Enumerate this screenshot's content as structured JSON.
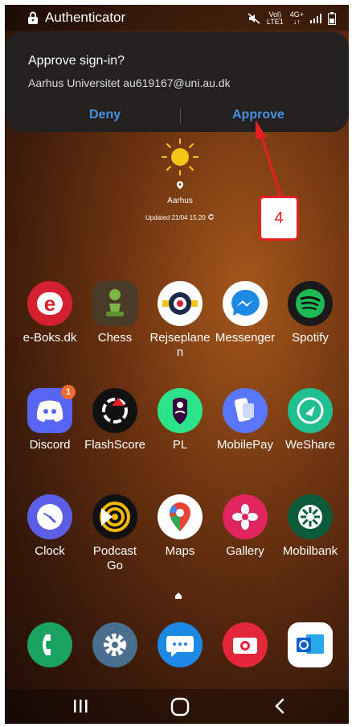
{
  "status_bar": {
    "app_name": "Authenticator",
    "signal_top": "Vol)",
    "signal_bottom": "LTE1",
    "net_top": "4G+",
    "net_bottom": "↓↑"
  },
  "notification": {
    "title": "Approve sign-in?",
    "subtitle": "Aarhus Universitet au619167@uni.au.dk",
    "deny_label": "Deny",
    "approve_label": "Approve",
    "accent_color": "#4a90e2"
  },
  "weather": {
    "location": "Aarhus",
    "updated": "Updated 21/04 15.20"
  },
  "annotation": {
    "step": "4",
    "color": "#e62020"
  },
  "apps": [
    {
      "label": "e-Boks.dk",
      "icon": "eboks-icon"
    },
    {
      "label": "Chess",
      "icon": "chess-pawn-icon"
    },
    {
      "label": "Rejseplane\nn",
      "icon": "rejseplanen-icon"
    },
    {
      "label": "Messenger",
      "icon": "messenger-icon"
    },
    {
      "label": "Spotify",
      "icon": "spotify-icon"
    },
    {
      "label": "Discord",
      "icon": "discord-icon",
      "badge": "1"
    },
    {
      "label": "FlashScore",
      "icon": "flashscore-icon"
    },
    {
      "label": "PL",
      "icon": "premier-league-icon"
    },
    {
      "label": "MobilePay",
      "icon": "mobilepay-icon"
    },
    {
      "label": "WeShare",
      "icon": "weshare-icon"
    },
    {
      "label": "Clock",
      "icon": "clock-icon"
    },
    {
      "label": "Podcast\nGo",
      "icon": "podcast-go-icon"
    },
    {
      "label": "Maps",
      "icon": "maps-pin-icon"
    },
    {
      "label": "Gallery",
      "icon": "gallery-flower-icon"
    },
    {
      "label": "Mobilbank",
      "icon": "mobilbank-icon"
    }
  ],
  "dock": [
    {
      "icon": "phone-icon"
    },
    {
      "icon": "settings-gear-icon"
    },
    {
      "icon": "messages-icon"
    },
    {
      "icon": "camera-icon"
    },
    {
      "icon": "outlook-icon"
    }
  ],
  "nav": {
    "recents_icon": "recents-icon",
    "home_icon": "home-icon",
    "back_icon": "back-icon"
  }
}
